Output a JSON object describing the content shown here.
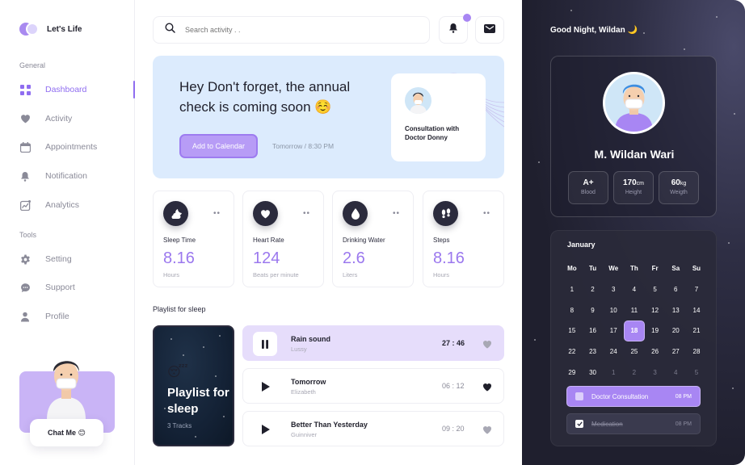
{
  "app": {
    "name": "Let's Life"
  },
  "sidebar": {
    "general_label": "General",
    "tools_label": "Tools",
    "items": [
      {
        "label": "Dashboard",
        "icon": "grid-icon"
      },
      {
        "label": "Activity",
        "icon": "heart-icon"
      },
      {
        "label": "Appointments",
        "icon": "calendar-icon"
      },
      {
        "label": "Notification",
        "icon": "bell-icon"
      },
      {
        "label": "Analytics",
        "icon": "chart-icon"
      }
    ],
    "tools": [
      {
        "label": "Setting",
        "icon": "gear-icon"
      },
      {
        "label": "Support",
        "icon": "chat-icon"
      },
      {
        "label": "Profile",
        "icon": "user-icon"
      }
    ],
    "chat_button": "Chat Me 😊"
  },
  "search": {
    "placeholder": "Search activity . ."
  },
  "banner": {
    "title": "Hey Don't forget, the annual check is coming soon ☺️",
    "button": "Add to Calendar",
    "time": "Tomorrow / 8:30 PM",
    "consult": "Consultation with Doctor Donny"
  },
  "stats": [
    {
      "label": "Sleep Time",
      "value": "8.16",
      "unit": "Hours",
      "icon": "cloud-moon-icon"
    },
    {
      "label": "Heart Rate",
      "value": "124",
      "unit": "Beats per minute",
      "icon": "heart-icon"
    },
    {
      "label": "Drinking Water",
      "value": "2.6",
      "unit": "Liters",
      "icon": "water-drop-icon"
    },
    {
      "label": "Steps",
      "value": "8.16",
      "unit": "Hours",
      "icon": "footsteps-icon"
    }
  ],
  "playlist": {
    "section_label": "Playlist for sleep",
    "card_title": "Playlist for sleep",
    "card_tracks": "3 Tracks",
    "tracks": [
      {
        "name": "Rain sound",
        "artist": "Lussy",
        "duration": "27 : 46"
      },
      {
        "name": "Tomorrow",
        "artist": "Elizabeth",
        "duration": "06 : 12"
      },
      {
        "name": "Better Than Yesterday",
        "artist": "Guinniver",
        "duration": "09 : 20"
      }
    ]
  },
  "right": {
    "greeting": "Good Night, Wildan 🌙",
    "name": "M. Wildan Wari",
    "metrics": [
      {
        "value": "A+",
        "unit": "",
        "label": "Blood"
      },
      {
        "value": "170",
        "unit": "cm",
        "label": "Height"
      },
      {
        "value": "60",
        "unit": "kg",
        "label": "Weigth"
      }
    ],
    "calendar": {
      "month": "January",
      "weekdays": [
        "Mo",
        "Tu",
        "We",
        "Th",
        "Fr",
        "Sa",
        "Su"
      ],
      "days": [
        "1",
        "2",
        "3",
        "4",
        "5",
        "6",
        "7",
        "8",
        "9",
        "10",
        "11",
        "12",
        "13",
        "14",
        "15",
        "16",
        "17",
        "18",
        "19",
        "20",
        "21",
        "22",
        "23",
        "24",
        "25",
        "26",
        "27",
        "28",
        "29",
        "30",
        "1",
        "2",
        "3",
        "4",
        "5"
      ],
      "selected": "18"
    },
    "todos": [
      {
        "label": "Doctor Consultation",
        "time": "08 PM"
      },
      {
        "label": "Medication",
        "time": "08 PM"
      }
    ]
  },
  "colors": {
    "accent": "#9b78ee",
    "banner_bg": "#dcebfd",
    "dark_panel": "#1f1f2e"
  }
}
